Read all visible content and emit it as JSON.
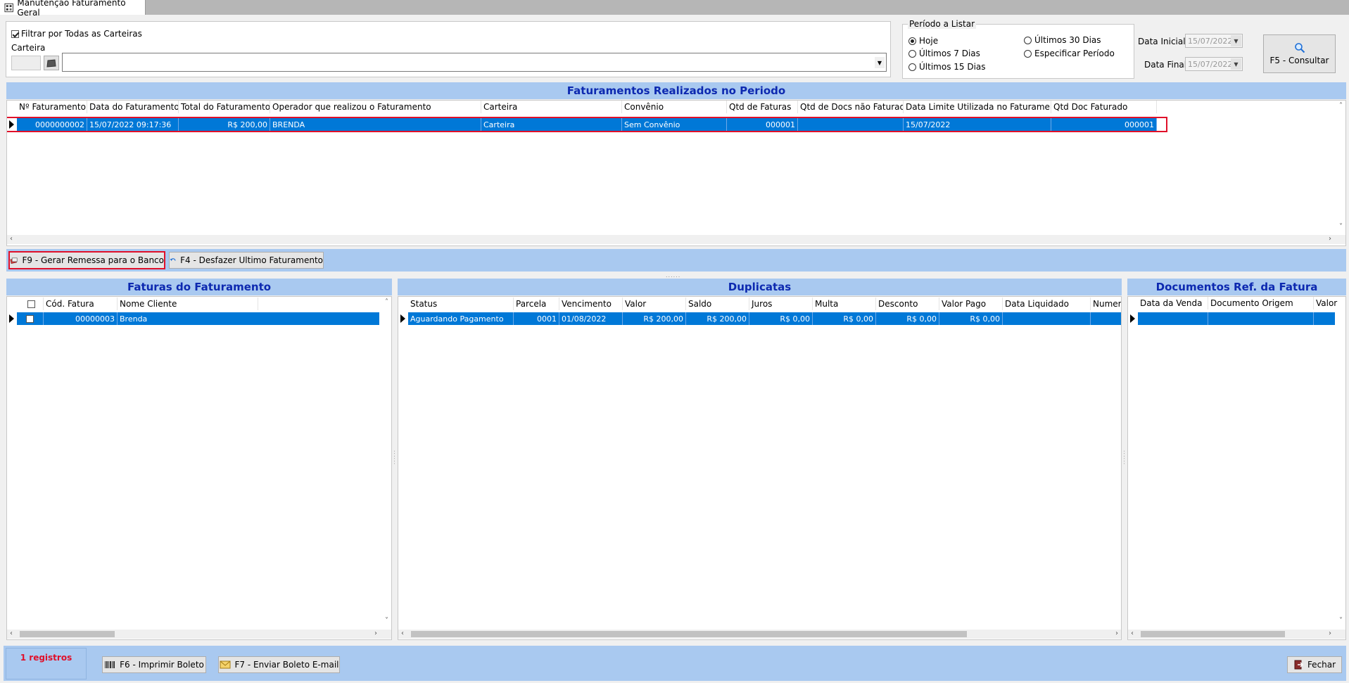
{
  "window": {
    "tab_title": "Manutenção Faturamento Geral"
  },
  "filter": {
    "all_carteiras_label": "Filtrar por Todas as Carteiras",
    "all_carteiras_checked": true,
    "carteira_label": "Carteira",
    "carteira_value": ""
  },
  "periodo": {
    "group_label": "Período a Listar",
    "options": [
      "Hoje",
      "Últimos 7 Dias",
      "Últimos 15 Dias",
      "Últimos 30 Dias",
      "Especificar Período"
    ],
    "selected": "Hoje",
    "data_inicial_label": "Data Inicial",
    "data_inicial": "15/07/2022",
    "data_final_label": "Data Final",
    "data_final": "15/07/2022",
    "consultar_label": "F5 - Consultar"
  },
  "faturamentos": {
    "title": "Faturamentos Realizados no Periodo",
    "columns": [
      "Nº Faturamento",
      "Data do Faturamento",
      "Total do Faturamento",
      "Operador que realizou o Faturamento",
      "Carteira",
      "Convênio",
      "Qtd de Faturas",
      "Qtd de Docs não Faturados",
      "Data Limite Utilizada no Faturamento",
      "Qtd Doc Faturado"
    ],
    "rows": [
      [
        "0000000002",
        "15/07/2022 09:17:36",
        "R$ 200,00",
        "BRENDA",
        "Carteira",
        "Sem Convênio",
        "000001",
        "",
        "15/07/2022",
        "000001"
      ]
    ],
    "gerar_remessa_label": "F9 - Gerar Remessa para o Banco",
    "desfazer_label": "F4 - Desfazer Ultimo Faturamento"
  },
  "faturas": {
    "title": "Faturas do Faturamento",
    "columns": [
      "",
      "Cód. Fatura",
      "Nome Cliente"
    ],
    "rows": [
      [
        "",
        "00000003",
        "Brenda"
      ]
    ]
  },
  "duplicatas": {
    "title": "Duplicatas",
    "columns": [
      "Status",
      "Parcela",
      "Vencimento",
      "Valor",
      "Saldo",
      "Juros",
      "Multa",
      "Desconto",
      "Valor Pago",
      "Data Liquidado",
      "Numero"
    ],
    "rows": [
      [
        "Aguardando Pagamento",
        "0001",
        "01/08/2022",
        "R$ 200,00",
        "R$ 200,00",
        "R$ 0,00",
        "R$ 0,00",
        "R$ 0,00",
        "R$ 0,00",
        "",
        ""
      ]
    ]
  },
  "documentos": {
    "title": "Documentos Ref. da Fatura",
    "columns": [
      "Data da Venda",
      "Documento Origem",
      "Valor"
    ],
    "rows": [
      [
        "",
        "",
        ""
      ]
    ]
  },
  "footer": {
    "registros": "1 registros",
    "imprimir_label": "F6 - Imprimir Boleto",
    "enviar_label": "F7 - Enviar Boleto E-mail",
    "fechar_label": "Fechar"
  },
  "colors": {
    "selection": "#0078d7",
    "section_band": "#a9c9f0",
    "section_title": "#0d29b0",
    "highlight_border": "#e0102a",
    "registros_text": "#e0102a"
  }
}
